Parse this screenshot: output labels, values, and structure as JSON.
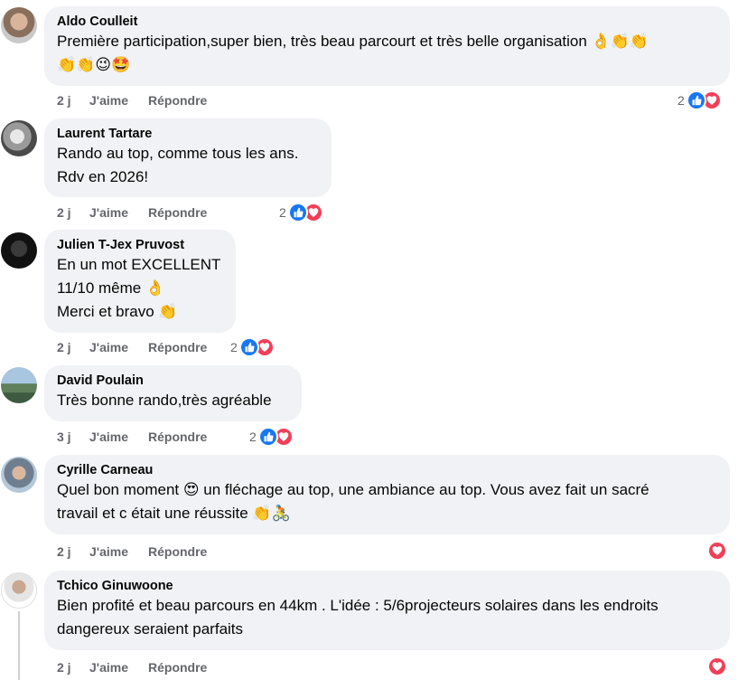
{
  "colors": {
    "bubble_bg": "#f0f2f5",
    "meta_text": "#65676b",
    "like_blue": "#1877f2",
    "love_red": "#f33e58"
  },
  "comments": [
    {
      "author": "Aldo Coulleit",
      "lines": [
        "Première participation,super bien, très beau parcourt et très belle organisation 👌👏👏",
        "👏👏😉🤩"
      ],
      "age": "2 j",
      "like": "J'aime",
      "reply": "Répondre",
      "reaction_count": "2",
      "reactions": [
        "like-icon",
        "love-icon"
      ]
    },
    {
      "author": "Laurent Tartare",
      "lines": [
        "Rando au top, comme tous les ans.",
        "Rdv en 2026!"
      ],
      "age": "2 j",
      "like": "J'aime",
      "reply": "Répondre",
      "reaction_count": "2",
      "reactions": [
        "like-icon",
        "love-icon"
      ]
    },
    {
      "author": "Julien T-Jex Pruvost",
      "lines": [
        "En un mot EXCELLENT",
        "11/10 même 👌",
        "Merci et bravo 👏"
      ],
      "age": "2 j",
      "like": "J'aime",
      "reply": "Répondre",
      "reaction_count": "2",
      "reactions": [
        "like-icon",
        "love-icon"
      ]
    },
    {
      "author": "David Poulain",
      "lines": [
        "Très bonne rando,très agréable"
      ],
      "age": "3 j",
      "like": "J'aime",
      "reply": "Répondre",
      "reaction_count": "2",
      "reactions": [
        "like-icon",
        "love-icon"
      ]
    },
    {
      "author": "Cyrille Carneau",
      "lines": [
        "Quel bon moment 😍 un fléchage au top, une ambiance au top. Vous avez fait un sacré",
        "travail et c était une réussite 👏🚴"
      ],
      "age": "2 j",
      "like": "J'aime",
      "reply": "Répondre",
      "reaction_count": "",
      "reactions": [
        "love-icon"
      ]
    },
    {
      "author": "Tchico Ginuwoone",
      "lines": [
        "Bien profité et beau parcours en 44km . L'idée : 5/6projecteurs solaires dans les endroits",
        "dangereux seraient parfaits"
      ],
      "age": "2 j",
      "like": "J'aime",
      "reply": "Répondre",
      "reaction_count": "",
      "reactions": [
        "love-icon"
      ]
    }
  ]
}
